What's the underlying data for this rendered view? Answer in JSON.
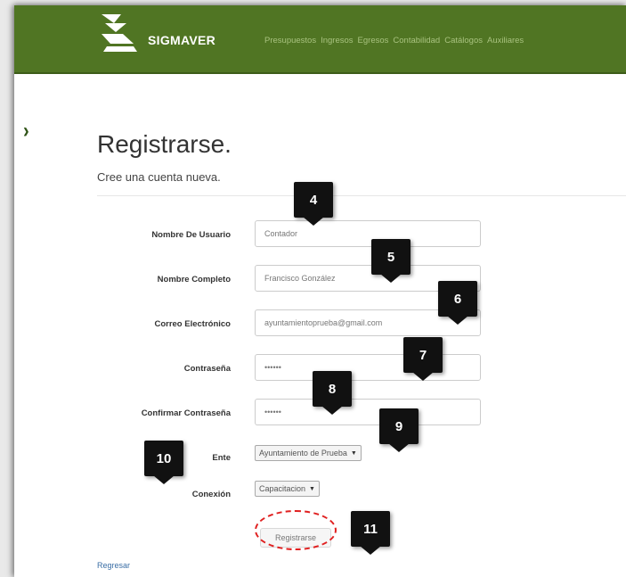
{
  "header": {
    "brand": "SIGMAVER",
    "nav_items": [
      "Presupuestos",
      "Ingresos",
      "Egresos",
      "Contabilidad",
      "Catálogos",
      "Auxiliares"
    ]
  },
  "page": {
    "title": "Registrarse.",
    "subtitle": "Cree una cuenta nueva."
  },
  "form": {
    "username_label": "Nombre De Usuario",
    "username_value": "Contador",
    "fullname_label": "Nombre Completo",
    "fullname_value": "Francisco González",
    "email_label": "Correo Electrónico",
    "email_value": "ayuntamientoprueba@gmail.com",
    "password_label": "Contraseña",
    "password_value": "••••••",
    "confirm_label": "Confirmar Contraseña",
    "confirm_value": "••••••",
    "ente_label": "Ente",
    "ente_value": "Ayuntamiento de Prueba",
    "conexion_label": "Conexión",
    "conexion_value": "Capacitacion",
    "submit_label": "Registrarse"
  },
  "footer": {
    "link": "Regresar"
  },
  "callouts": [
    "4",
    "5",
    "6",
    "7",
    "8",
    "9",
    "10",
    "11"
  ],
  "colors": {
    "navbar": "#507523",
    "nav_text": "#a8c27f",
    "callout": "#111111",
    "highlight": "#e02020"
  }
}
